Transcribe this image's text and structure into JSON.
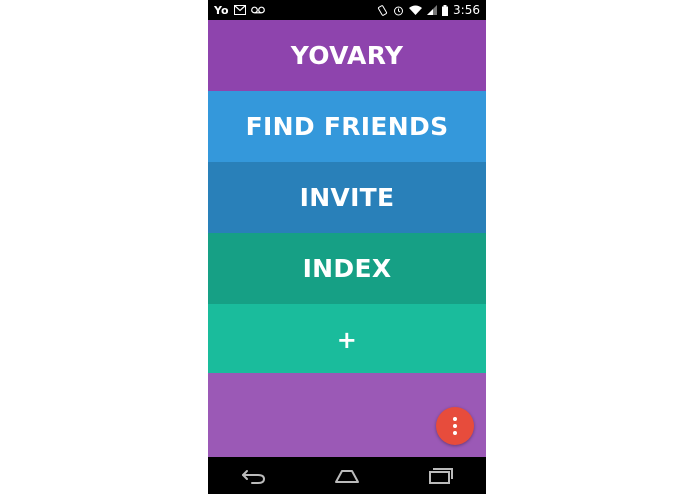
{
  "status_bar": {
    "carrier": "Yo",
    "time": "3:56",
    "left_icons": [
      "gmail-icon",
      "voicemail-icon"
    ],
    "right_icons": [
      "rotate-icon",
      "alarm-icon",
      "wifi-icon",
      "signal-icon",
      "battery-icon"
    ]
  },
  "rows": [
    {
      "label": "YOVARY",
      "color": "#8e44ad"
    },
    {
      "label": "FIND FRIENDS",
      "color": "#3498db"
    },
    {
      "label": "INVITE",
      "color": "#2980b9"
    },
    {
      "label": "INDEX",
      "color": "#16a085"
    },
    {
      "label": "+",
      "color": "#1abc9c"
    }
  ],
  "filler_color": "#9b59b6",
  "fab": {
    "icon": "more-vertical-icon",
    "color": "#e74c3c"
  },
  "nav_bar": {
    "buttons": [
      "back-icon",
      "home-icon",
      "recent-apps-icon"
    ]
  }
}
